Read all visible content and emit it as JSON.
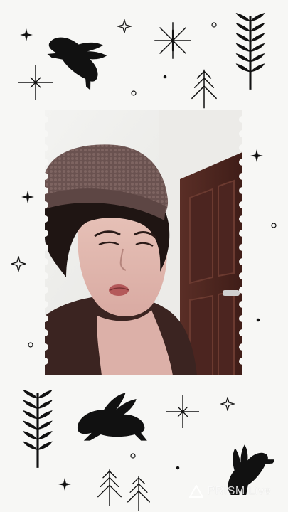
{
  "watermark": {
    "brand": "PRISM Live",
    "icon": "triangle-logo-icon"
  },
  "colors": {
    "background": "#f7f7f5",
    "ink": "#111111"
  },
  "decorations": [
    "rabbit-icon",
    "wheat-icon",
    "snowflake-icon",
    "pine-tree-icon",
    "sparkle-icon",
    "dot-icon"
  ]
}
